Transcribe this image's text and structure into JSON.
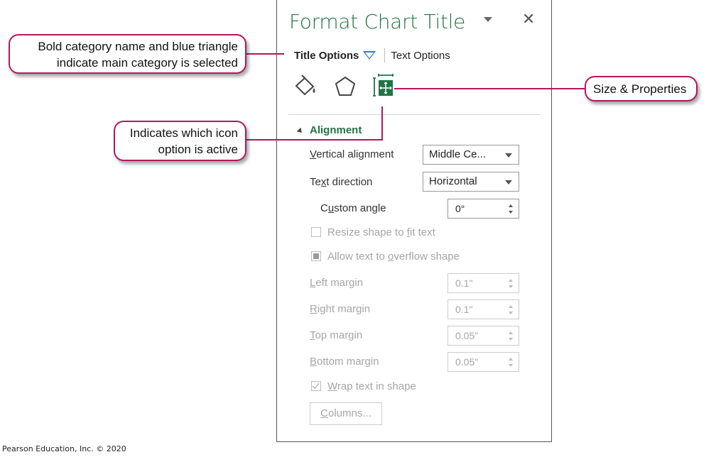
{
  "pane": {
    "title": "Format Chart Title",
    "close_glyph": "✕",
    "categories": {
      "selected": "Title Options",
      "other": "Text Options"
    },
    "icons": [
      "fill-line-icon",
      "effects-icon",
      "size-properties-icon"
    ],
    "section": "Alignment",
    "vertical_alignment": {
      "label_pre": "",
      "label_ul": "V",
      "label_post": "ertical alignment",
      "value": "Middle Ce..."
    },
    "text_direction": {
      "label_pre": "Te",
      "label_ul": "x",
      "label_post": "t direction",
      "value": "Horizontal"
    },
    "custom_angle": {
      "label_pre": "C",
      "label_ul": "u",
      "label_post": "stom angle",
      "value": "0°"
    },
    "resize_shape": {
      "label_pre": "Resize shape to ",
      "label_ul": "f",
      "label_post": "it text"
    },
    "allow_overflow": {
      "label_pre": "Allow text to ",
      "label_ul": "o",
      "label_post": "verflow shape"
    },
    "left_margin": {
      "label_ul": "L",
      "label_post": "eft margin",
      "value": "0.1\""
    },
    "right_margin": {
      "label_ul": "R",
      "label_post": "ight margin",
      "value": "0.1\""
    },
    "top_margin": {
      "label_ul": "T",
      "label_post": "op margin",
      "value": "0.05\""
    },
    "bottom_margin": {
      "label_ul": "B",
      "label_post": "ottom margin",
      "value": "0.05\""
    },
    "wrap_text": {
      "label_ul": "W",
      "label_post": "rap text in shape"
    },
    "columns_button": {
      "label_ul": "C",
      "label_post": "olumns..."
    }
  },
  "callouts": {
    "category": {
      "line1": "Bold category name and blue triangle",
      "line2": "indicate main category is selected"
    },
    "size_properties": "Size & Properties",
    "icon_active": {
      "line1": "Indicates which icon",
      "line2": "option is active"
    }
  },
  "colors": {
    "accent_green": "#217346",
    "callout_border": "#b5175d",
    "triangle_blue": "#2f7ec2"
  },
  "footer": "Pearson Education, Inc. © 2020"
}
